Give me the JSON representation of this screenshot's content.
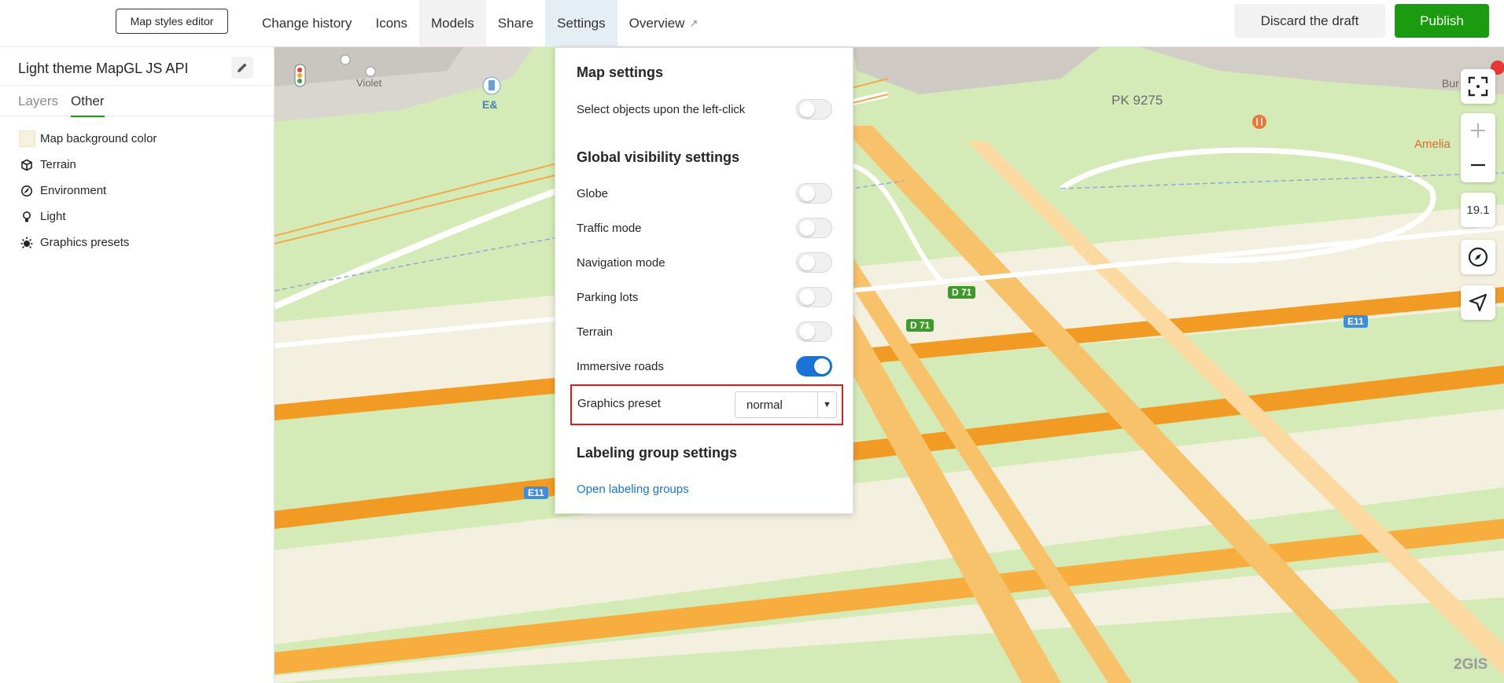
{
  "topbar": {
    "editor_button": "Map styles editor",
    "nav": [
      {
        "label": "Change history"
      },
      {
        "label": "Icons"
      },
      {
        "label": "Models"
      },
      {
        "label": "Share"
      },
      {
        "label": "Settings"
      },
      {
        "label": "Overview",
        "icon": "external-link-icon"
      }
    ],
    "overview_arrow": "↗",
    "discard_label": "Discard the draft",
    "publish_label": "Publish",
    "colors": {
      "publish": "#1b9b0f",
      "active_tab": "#e5edf5"
    }
  },
  "left_panel": {
    "title": "Light theme MapGL JS API",
    "tabs": [
      {
        "label": "Layers"
      },
      {
        "label": "Other",
        "active": true
      }
    ],
    "items": [
      {
        "label": "Map background color",
        "icon": "color-swatch",
        "color": "#f6f2de"
      },
      {
        "label": "Terrain",
        "icon": "cube-icon"
      },
      {
        "label": "Environment",
        "icon": "environment-icon"
      },
      {
        "label": "Light",
        "icon": "bulb-icon"
      },
      {
        "label": "Graphics presets",
        "icon": "sun-icon"
      }
    ]
  },
  "settings_panel": {
    "map_settings_title": "Map settings",
    "select_objects_label": "Select objects upon the left-click",
    "select_objects_on": false,
    "global_title": "Global visibility settings",
    "global_toggles": [
      {
        "label": "Globe",
        "on": false
      },
      {
        "label": "Traffic mode",
        "on": false
      },
      {
        "label": "Navigation mode",
        "on": false
      },
      {
        "label": "Parking lots",
        "on": false
      },
      {
        "label": "Terrain",
        "on": false
      },
      {
        "label": "Immersive roads",
        "on": true
      }
    ],
    "graphics_preset_label": "Graphics preset",
    "graphics_preset_value": "normal",
    "labeling_title": "Labeling group settings",
    "labeling_link": "Open labeling groups"
  },
  "map": {
    "labels": {
      "violet": "Violet",
      "e_and": "E&",
      "pk": "PK 9275",
      "amelia": "Amelia",
      "bur": "Bur",
      "d71_a": "D 71",
      "d71_b": "D 71",
      "e11_a": "E11",
      "e11_b": "E11"
    },
    "zoom_level": "19.1",
    "watermark": "2GIS"
  }
}
